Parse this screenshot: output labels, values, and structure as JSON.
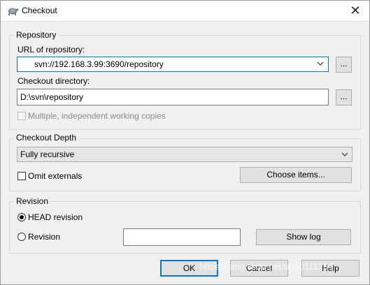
{
  "window": {
    "title": "Checkout",
    "close_glyph": "✕"
  },
  "repository": {
    "group_label": "Repository",
    "url_label": "URL of repository:",
    "url_value": "svn://192.168.3.99:3690/repository",
    "dir_label": "Checkout directory:",
    "dir_value": "D:\\svn\\repository",
    "browse_label": "...",
    "multiple_wc_label": "Multiple, independent working copies"
  },
  "depth": {
    "group_label": "Checkout Depth",
    "selected": "Fully recursive",
    "omit_externals_label": "Omit externals",
    "choose_items_label": "Choose items..."
  },
  "revision": {
    "group_label": "Revision",
    "head_label": "HEAD revision",
    "revision_label": "Revision",
    "revision_value": "",
    "show_log_label": "Show log"
  },
  "footer": {
    "ok_label": "OK",
    "cancel_label": "Cancel",
    "help_label": "Help"
  },
  "watermark_text": "https://blog.csdn.net/u010111264",
  "icons": [
    "turtle-icon",
    "close-icon",
    "chevron-down-icon"
  ],
  "colors": {
    "focus_border": "#0078d7",
    "dialog_bg": "#f0f0f0"
  }
}
